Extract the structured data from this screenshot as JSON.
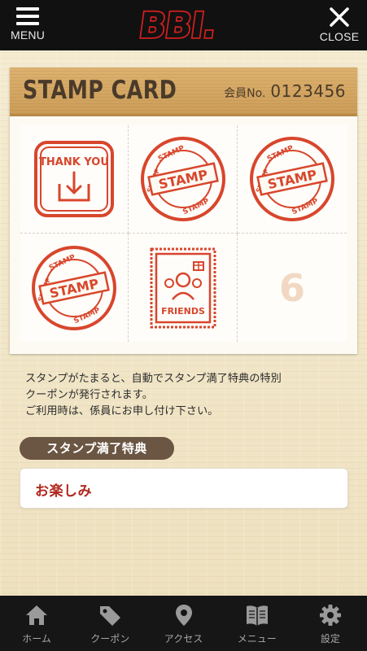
{
  "header": {
    "menu_label": "MENU",
    "close_label": "CLOSE",
    "logo_text": "BBI."
  },
  "card": {
    "title": "STAMP CARD",
    "member_label": "会員No.",
    "member_number": "0123456",
    "stamps": [
      {
        "kind": "thank-you",
        "text": "THANK YOU"
      },
      {
        "kind": "stamp",
        "text": "STAMP"
      },
      {
        "kind": "stamp",
        "text": "STAMP"
      },
      {
        "kind": "stamp",
        "text": "STAMP"
      },
      {
        "kind": "friends",
        "text": "FRIENDS"
      },
      {
        "kind": "empty",
        "number": "6"
      }
    ]
  },
  "description": {
    "line1": "スタンプがたまると、自動でスタンプ満了特典の特別",
    "line2": "クーポンが発行されます。",
    "line3": "ご利用時は、係員にお申し付け下さい。"
  },
  "reward": {
    "section_label": "スタンプ満了特典",
    "value": "お楽しみ"
  },
  "bottom_nav": [
    {
      "label": "ホーム",
      "icon": "home-icon"
    },
    {
      "label": "クーポン",
      "icon": "tag-icon"
    },
    {
      "label": "アクセス",
      "icon": "map-pin-icon"
    },
    {
      "label": "メニュー",
      "icon": "book-icon"
    },
    {
      "label": "設定",
      "icon": "gear-icon"
    }
  ],
  "colors": {
    "stamp_red": "#d8462c",
    "header_bg": "#111111",
    "wood": "#d6a965",
    "reward_text": "#b0271e"
  }
}
